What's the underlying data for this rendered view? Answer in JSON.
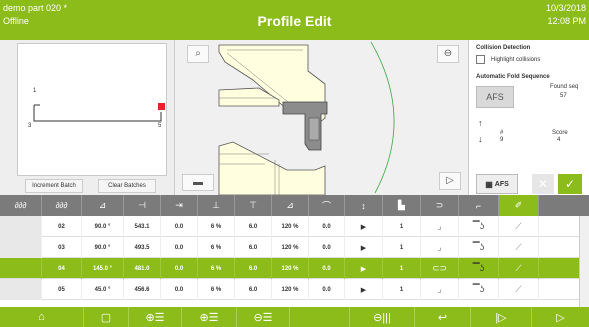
{
  "header": {
    "part_name": "demo part 020 *",
    "status": "Offline",
    "title": "Profile Edit",
    "date": "10/3/2018",
    "time": "12:08 PM"
  },
  "left_panel": {
    "labels": {
      "top": "1",
      "bottom_left": "3",
      "bottom_right": "5"
    },
    "increment_batch": "Increment Batch",
    "clear_batches": "Clear Batches"
  },
  "right_panel": {
    "collision_title": "Collision Detection",
    "highlight_collisions": "Highlight collisions",
    "afs_title": "Automatic Fold Sequence",
    "afs_button": "AFS",
    "found_seq_label": "Found seq",
    "found_seq_value": "57",
    "hash_label": "#",
    "hash_value": "9",
    "score_label": "Score",
    "score_value": "4",
    "afs_toggle": "AFS"
  },
  "table": {
    "rows": [
      {
        "num": "02",
        "angle": "90.0 °",
        "length": "543.1",
        "c3": "0.0",
        "c4": "6 %",
        "c5": "6.0",
        "c6": "120 %",
        "c7": "0.0",
        "c9": "1"
      },
      {
        "num": "03",
        "angle": "90.0 °",
        "length": "493.5",
        "c3": "0.0",
        "c4": "6 %",
        "c5": "6.0",
        "c6": "120 %",
        "c7": "0.0",
        "c9": "1"
      },
      {
        "num": "04",
        "angle": "145.0 °",
        "length": "481.0",
        "c3": "0.0",
        "c4": "6 %",
        "c5": "6.0",
        "c6": "120 %",
        "c7": "0.0",
        "c9": "1"
      },
      {
        "num": "05",
        "angle": "45.0 °",
        "length": "456.6",
        "c3": "0.0",
        "c4": "6 %",
        "c5": "6.0",
        "c6": "120 %",
        "c7": "0.0",
        "c9": "1"
      }
    ]
  },
  "colors": {
    "accent": "#8cbc1a",
    "marker": "#e8202a",
    "header_gray": "#7b7b7b"
  }
}
